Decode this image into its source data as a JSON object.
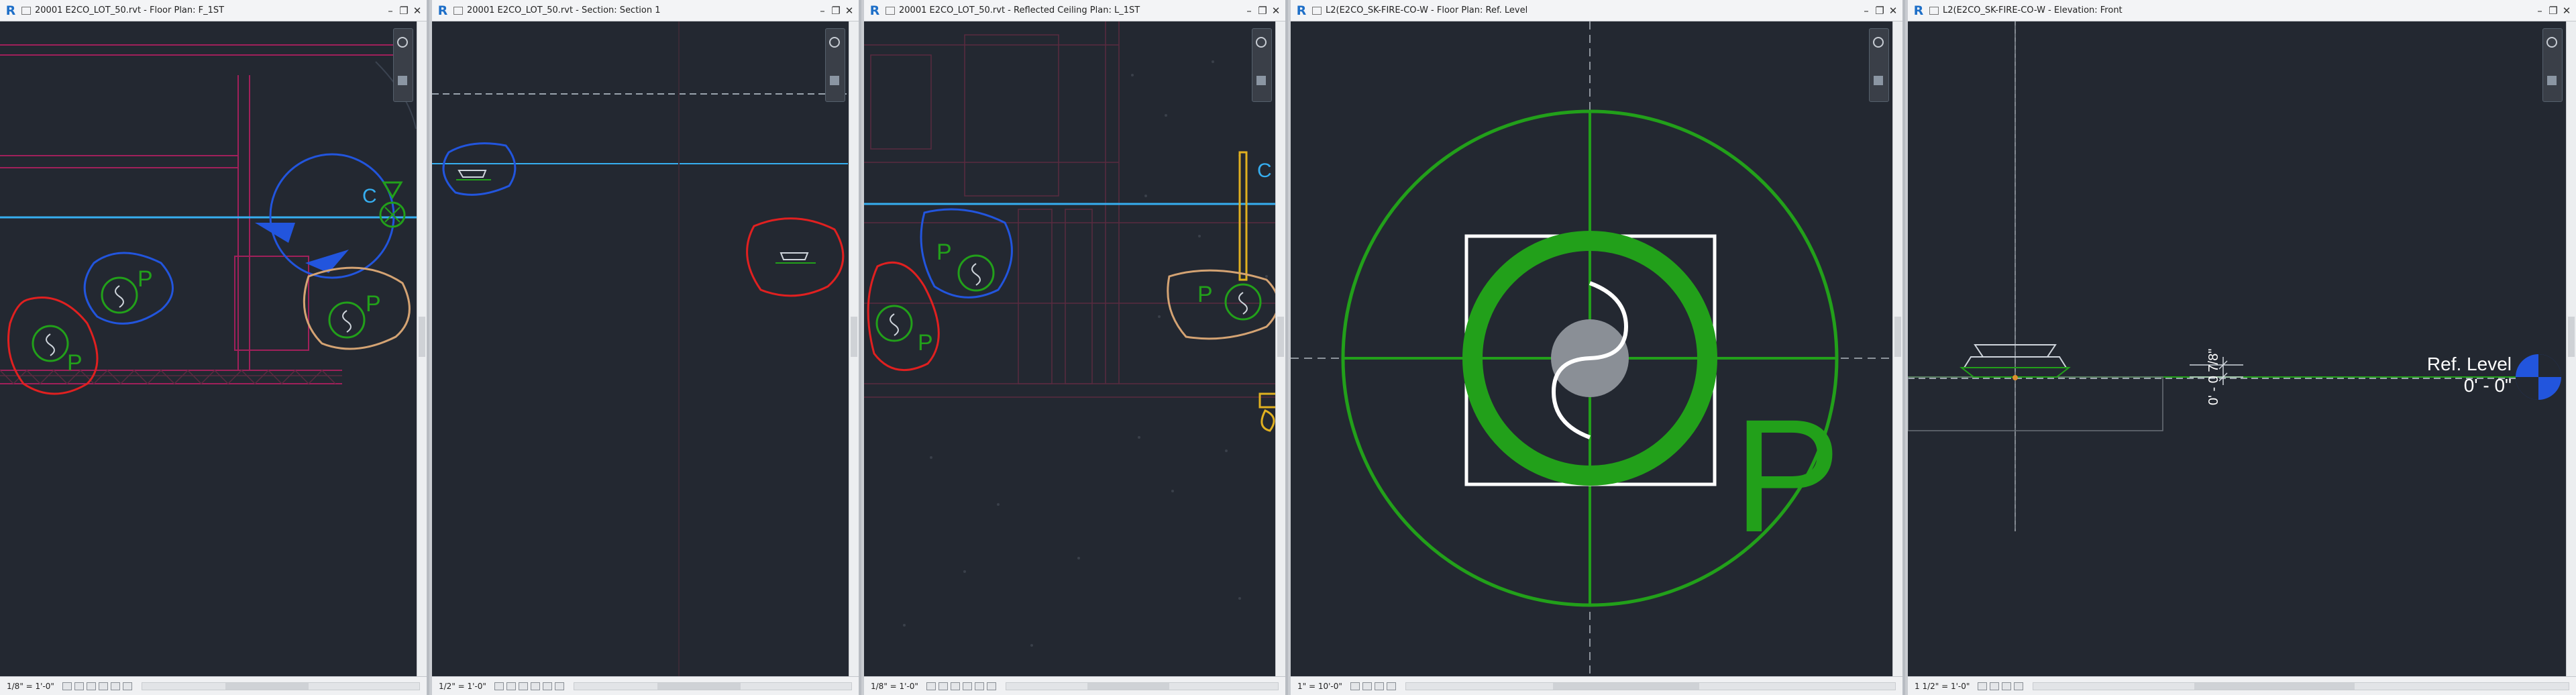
{
  "app": {
    "logo_letter": "R"
  },
  "colors": {
    "canvas_bg": "#232831",
    "fire_green": "#22a01a",
    "markup_red": "#e02020",
    "markup_blue": "#2255dd",
    "markup_tan": "#d4a373",
    "level_line_cyan": "#36aef0",
    "wall_magenta": "#a0205a",
    "yellow": "#e0b020"
  },
  "views": [
    {
      "title": "20001 E2CO_LOT_50.rvt - Floor Plan: F_1ST",
      "scale": "1/8\" = 1'-0\"",
      "labels": {
        "c_label": "C",
        "p1": "P",
        "p2": "P",
        "p3": "P"
      }
    },
    {
      "title": "20001 E2CO_LOT_50.rvt - Section: Section 1",
      "scale": "1/2\" = 1'-0\""
    },
    {
      "title": "20001 E2CO_LOT_50.rvt - Reflected Ceiling Plan: L_1ST",
      "scale": "1/8\" = 1'-0\"",
      "labels": {
        "c_label": "C",
        "p1": "P",
        "p2": "P",
        "p3": "P"
      }
    },
    {
      "title": "L2(E2CO_SK-FIRE-CO-W - Floor Plan: Ref. Level",
      "scale": "1\" = 10'-0\"",
      "labels": {
        "big_p": "P"
      }
    },
    {
      "title": "L2(E2CO_SK-FIRE-CO-W - Elevation: Front",
      "scale": "1 1/2\" = 1'-0\"",
      "labels": {
        "ref_level": "Ref. Level",
        "ref_elev": "0' - 0\"",
        "dim": "0' - 0 7/8\""
      }
    }
  ],
  "window_buttons": {
    "minimize": "–",
    "restore": "❐",
    "close": "✕"
  }
}
